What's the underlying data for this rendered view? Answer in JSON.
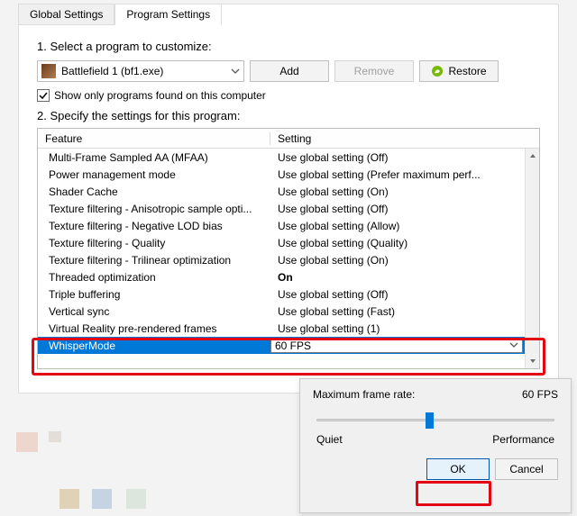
{
  "tabs": {
    "global": "Global Settings",
    "program": "Program Settings"
  },
  "step1": "1. Select a program to customize:",
  "program": {
    "name": "Battlefield 1 (bf1.exe)"
  },
  "buttons": {
    "add": "Add",
    "remove": "Remove",
    "restore": "Restore",
    "ok": "OK",
    "cancel": "Cancel"
  },
  "checkbox": {
    "label": "Show only programs found on this computer"
  },
  "step2": "2. Specify the settings for this program:",
  "columns": {
    "feature": "Feature",
    "setting": "Setting"
  },
  "rows": [
    {
      "feature": "Multi-Frame Sampled AA (MFAA)",
      "setting": "Use global setting (Off)"
    },
    {
      "feature": "Power management mode",
      "setting": "Use global setting (Prefer maximum perf..."
    },
    {
      "feature": "Shader Cache",
      "setting": "Use global setting (On)"
    },
    {
      "feature": "Texture filtering - Anisotropic sample opti...",
      "setting": "Use global setting (Off)"
    },
    {
      "feature": "Texture filtering - Negative LOD bias",
      "setting": "Use global setting (Allow)"
    },
    {
      "feature": "Texture filtering - Quality",
      "setting": "Use global setting (Quality)"
    },
    {
      "feature": "Texture filtering - Trilinear optimization",
      "setting": "Use global setting (On)"
    },
    {
      "feature": "Threaded optimization",
      "setting": "On",
      "bold": true
    },
    {
      "feature": "Triple buffering",
      "setting": "Use global setting (Off)"
    },
    {
      "feature": "Vertical sync",
      "setting": "Use global setting (Fast)"
    },
    {
      "feature": "Virtual Reality pre-rendered frames",
      "setting": "Use global setting (1)"
    },
    {
      "feature": "WhisperMode",
      "setting": "60 FPS",
      "selected": true
    }
  ],
  "popup": {
    "label": "Maximum frame rate:",
    "value": "60 FPS",
    "left": "Quiet",
    "right": "Performance"
  }
}
